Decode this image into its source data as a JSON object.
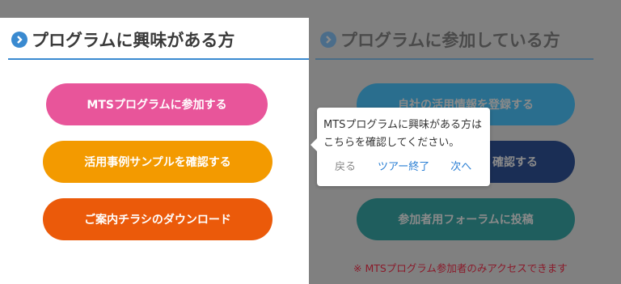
{
  "left_section": {
    "title": "プログラムに興味がある方",
    "buttons": [
      {
        "label": "MTSプログラムに参加する",
        "color": "#e8559a"
      },
      {
        "label": "活用事例サンプルを確認する",
        "color": "#f39a00"
      },
      {
        "label": "ご案内チラシのダウンロード",
        "color": "#eb5a0a"
      }
    ]
  },
  "right_section": {
    "title": "プログラムに参加している方",
    "buttons": [
      {
        "label": "自社の活用情報を登録する",
        "color": "#2a6e8e"
      },
      {
        "label": "確認する",
        "color": "#1a2e55"
      },
      {
        "label": "参加者用フォーラムに投稿",
        "color": "#1f5e5e"
      }
    ],
    "notice": "※ MTSプログラム参加者のみアクセスできます"
  },
  "tour_tooltip": {
    "line1": "MTSプログラムに興味がある方は",
    "line2": "こちらを確認してください。",
    "back": "戻る",
    "end": "ツアー終了",
    "next": "次へ"
  },
  "colors": {
    "accent_blue": "#3a8ad0",
    "dim_overlay": "#808080",
    "notice_red": "#8a1a2a"
  },
  "icons": {
    "section_bullet": "chevron-right-circle-icon"
  }
}
